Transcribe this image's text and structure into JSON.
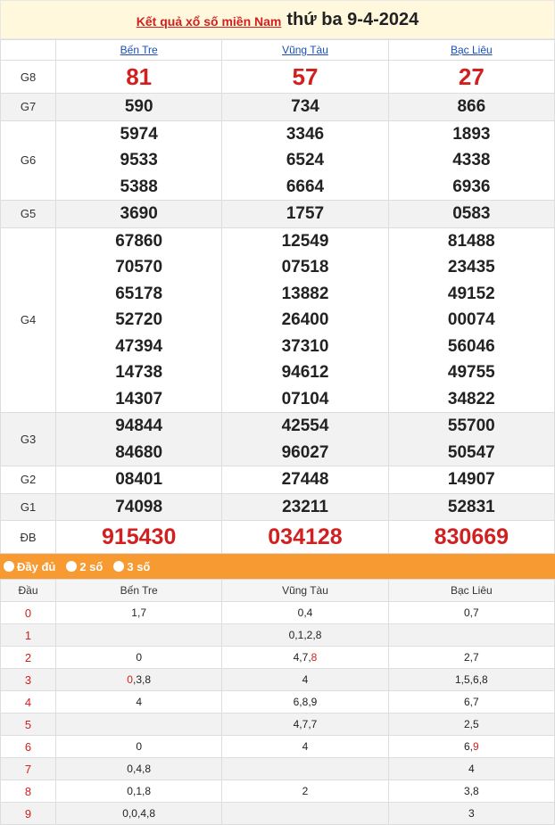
{
  "title": {
    "link": "Kết quả xổ số miền Nam",
    "date": "thứ ba 9-4-2024"
  },
  "provinces": [
    "Bến Tre",
    "Vũng Tàu",
    "Bạc Liêu"
  ],
  "prizes": [
    {
      "label": "G8",
      "cols": [
        [
          "81"
        ],
        [
          "57"
        ],
        [
          "27"
        ]
      ]
    },
    {
      "label": "G7",
      "cols": [
        [
          "590"
        ],
        [
          "734"
        ],
        [
          "866"
        ]
      ]
    },
    {
      "label": "G6",
      "cols": [
        [
          "5974",
          "9533",
          "5388"
        ],
        [
          "3346",
          "6524",
          "6664"
        ],
        [
          "1893",
          "4338",
          "6936"
        ]
      ]
    },
    {
      "label": "G5",
      "cols": [
        [
          "3690"
        ],
        [
          "1757"
        ],
        [
          "0583"
        ]
      ]
    },
    {
      "label": "G4",
      "cols": [
        [
          "67860",
          "70570",
          "65178",
          "52720",
          "47394",
          "14738",
          "14307"
        ],
        [
          "12549",
          "07518",
          "13882",
          "26400",
          "37310",
          "94612",
          "07104"
        ],
        [
          "81488",
          "23435",
          "49152",
          "00074",
          "56046",
          "49755",
          "34822"
        ]
      ]
    },
    {
      "label": "G3",
      "cols": [
        [
          "94844",
          "84680"
        ],
        [
          "42554",
          "96027"
        ],
        [
          "55700",
          "50547"
        ]
      ]
    },
    {
      "label": "G2",
      "cols": [
        [
          "08401"
        ],
        [
          "27448"
        ],
        [
          "14907"
        ]
      ]
    },
    {
      "label": "G1",
      "cols": [
        [
          "74098"
        ],
        [
          "23211"
        ],
        [
          "52831"
        ]
      ]
    },
    {
      "label": "ĐB",
      "cols": [
        [
          "915430"
        ],
        [
          "034128"
        ],
        [
          "830669"
        ]
      ]
    }
  ],
  "options": [
    "Đầy đủ",
    "2 số",
    "3 số"
  ],
  "loto": {
    "header": "Đầu",
    "rows": [
      {
        "dau": "0",
        "cells": [
          "1,7",
          "0,4",
          "0,7"
        ]
      },
      {
        "dau": "1",
        "cells": [
          "",
          "0,1,2,8",
          ""
        ]
      },
      {
        "dau": "2",
        "cells": [
          "0",
          "4,7,[8]",
          "2,7"
        ]
      },
      {
        "dau": "3",
        "cells": [
          "[0],3,8",
          "4",
          "1,5,6,8"
        ]
      },
      {
        "dau": "4",
        "cells": [
          "4",
          "6,8,9",
          "6,7"
        ]
      },
      {
        "dau": "5",
        "cells": [
          "",
          "4,7,7",
          "2,5"
        ]
      },
      {
        "dau": "6",
        "cells": [
          "0",
          "4",
          "6,[9]"
        ]
      },
      {
        "dau": "7",
        "cells": [
          "0,4,8",
          "",
          "4"
        ]
      },
      {
        "dau": "8",
        "cells": [
          "0,1,8",
          "2",
          "3,8"
        ]
      },
      {
        "dau": "9",
        "cells": [
          "0,0,4,8",
          "",
          "3"
        ]
      }
    ]
  }
}
